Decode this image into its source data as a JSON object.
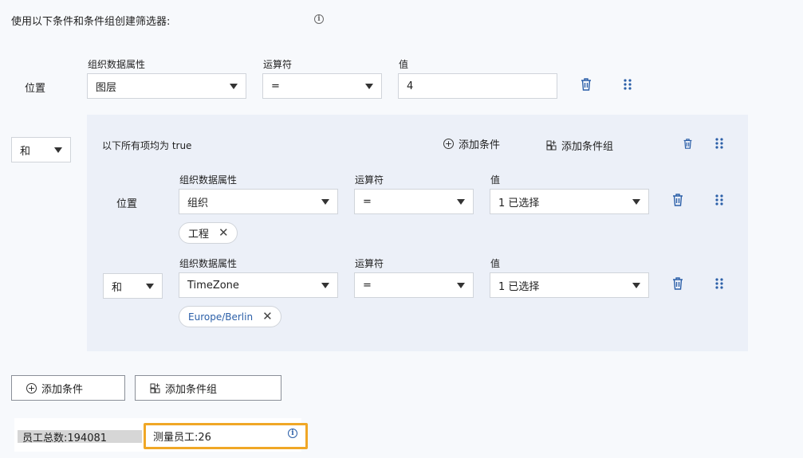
{
  "intro": {
    "text": "使用以下条件和条件组创建筛选器:"
  },
  "cond1": {
    "position_label": "位置",
    "attr_label": "组织数据属性",
    "attr_value": "图层",
    "op_label": "运算符",
    "op_value": "=",
    "val_label": "值",
    "val_value": "4"
  },
  "group": {
    "connector": "和",
    "header": "以下所有项均为 true",
    "add_condition": "添加条件",
    "add_group": "添加条件组",
    "cond_a": {
      "position_label": "位置",
      "attr_label": "组织数据属性",
      "attr_value": "组织",
      "op_label": "运算符",
      "op_value": "=",
      "val_label": "值",
      "val_value": "1 已选择",
      "chip": "工程"
    },
    "cond_b": {
      "connector": "和",
      "attr_label": "组织数据属性",
      "attr_value": "TimeZone",
      "op_label": "运算符",
      "op_value": "=",
      "val_label": "值",
      "val_value": "1 已选择",
      "chip": "Europe/Berlin"
    }
  },
  "footer": {
    "add_condition": "添加条件",
    "add_group": "添加条件组",
    "total_employees": "员工总数:194081",
    "measured_employees": "测量员工:26"
  },
  "colors": {
    "accent": "#2b5fa8",
    "highlight": "#f0a726",
    "group_bg": "#ecf0f8"
  }
}
